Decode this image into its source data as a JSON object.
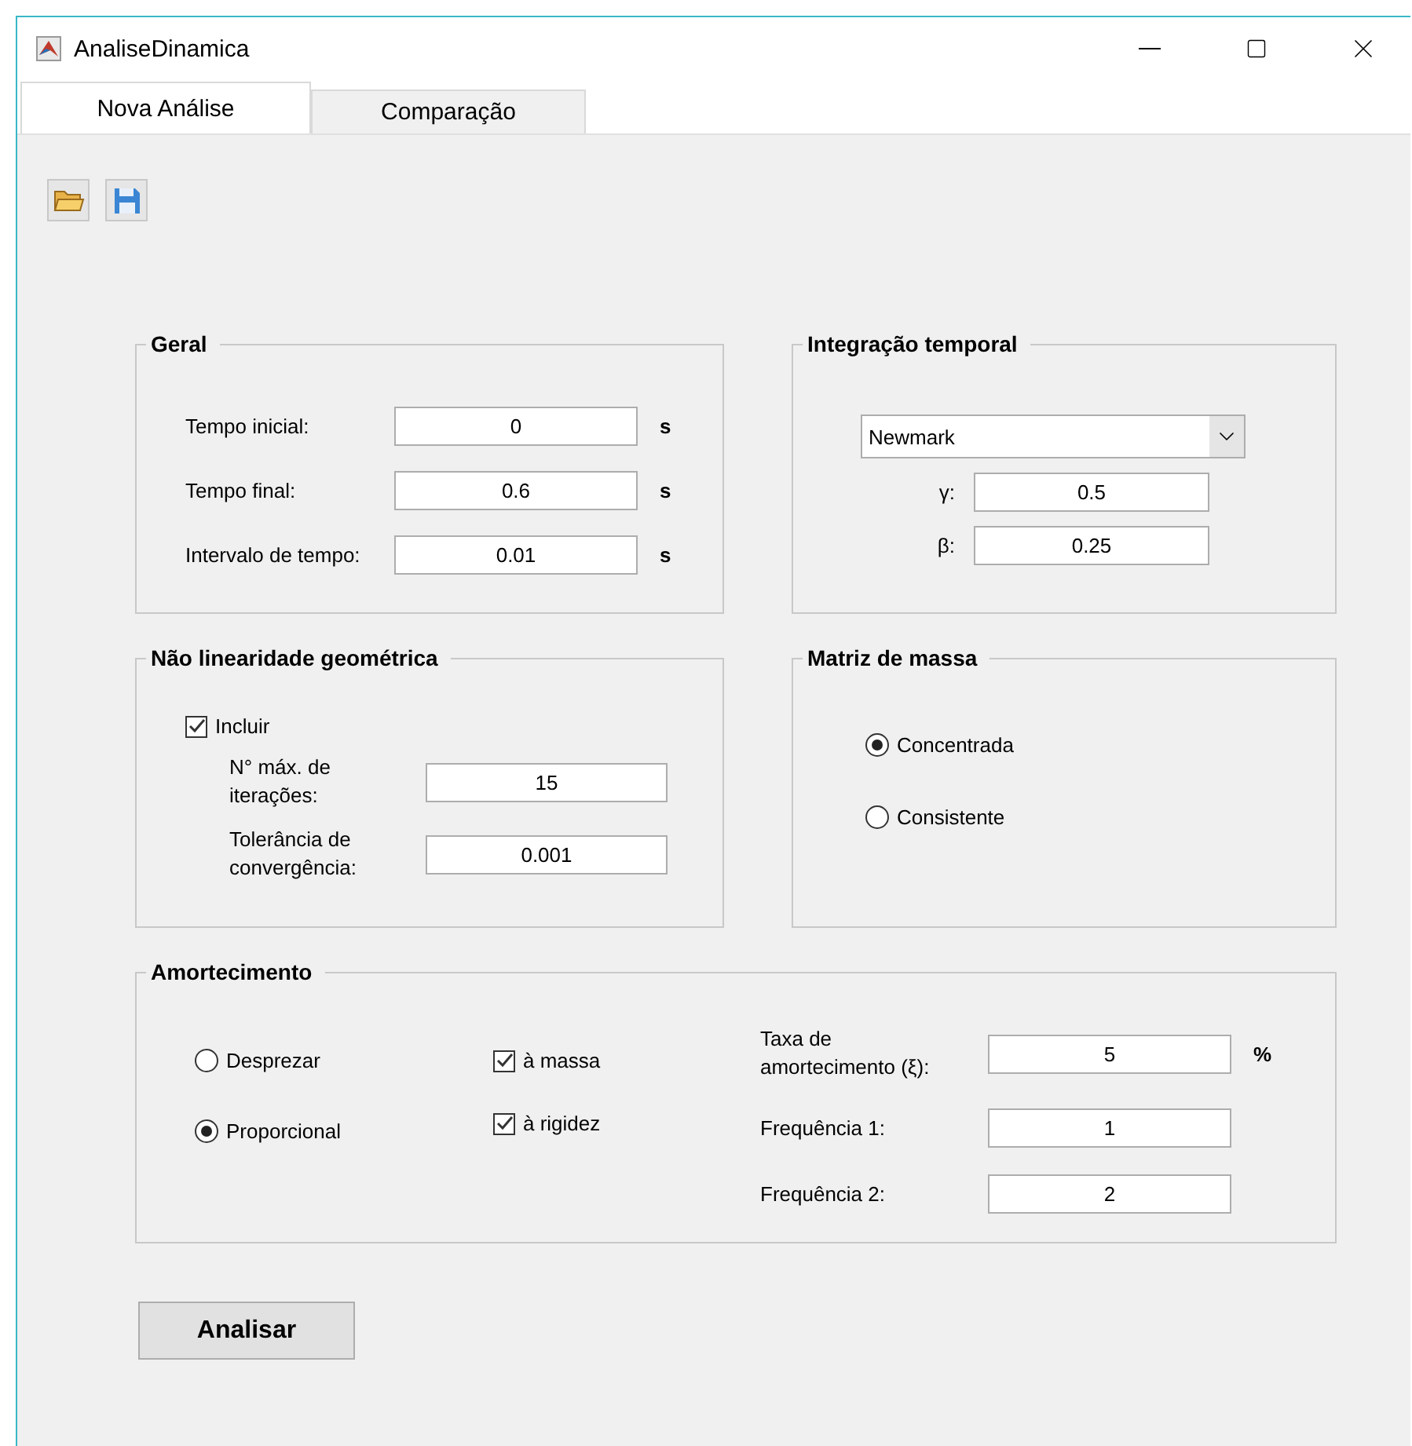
{
  "window": {
    "title": "AnaliseDinamica"
  },
  "tabs": [
    {
      "label": "Nova Análise",
      "selected": true
    },
    {
      "label": "Comparação",
      "selected": false
    }
  ],
  "geral": {
    "title": "Geral",
    "fields": [
      {
        "label": "Tempo inicial:",
        "value": "0",
        "unit": "s"
      },
      {
        "label": "Tempo final:",
        "value": "0.6",
        "unit": "s"
      },
      {
        "label": "Intervalo de tempo:",
        "value": "0.01",
        "unit": "s"
      }
    ]
  },
  "integracao": {
    "title": "Integração temporal",
    "method": "Newmark",
    "fields": [
      {
        "label": "γ:",
        "value": "0.5"
      },
      {
        "label": "β:",
        "value": "0.25"
      }
    ]
  },
  "nao_linearidade": {
    "title": "Não linearidade geométrica",
    "include": {
      "label": "Incluir",
      "checked": true
    },
    "fields": [
      {
        "label": "N° máx. de iterações:",
        "value": "15"
      },
      {
        "label": "Tolerância de convergência:",
        "value": "0.001"
      }
    ]
  },
  "matriz_massa": {
    "title": "Matriz de massa",
    "options": [
      {
        "label": "Concentrada",
        "selected": true
      },
      {
        "label": "Consistente",
        "selected": false
      }
    ]
  },
  "amortecimento": {
    "title": "Amortecimento",
    "options": [
      {
        "label": "Desprezar",
        "selected": false
      },
      {
        "label": "Proporcional",
        "selected": true
      }
    ],
    "checks": [
      {
        "label": "à massa",
        "checked": true
      },
      {
        "label": "à rigidez",
        "checked": true
      }
    ],
    "fields": [
      {
        "label": "Taxa de amortecimento (ξ):",
        "value": "5",
        "unit": "%"
      },
      {
        "label": "Frequência 1:",
        "value": "1"
      },
      {
        "label": "Frequência 2:",
        "value": "2"
      }
    ]
  },
  "analyze_button": "Analisar"
}
